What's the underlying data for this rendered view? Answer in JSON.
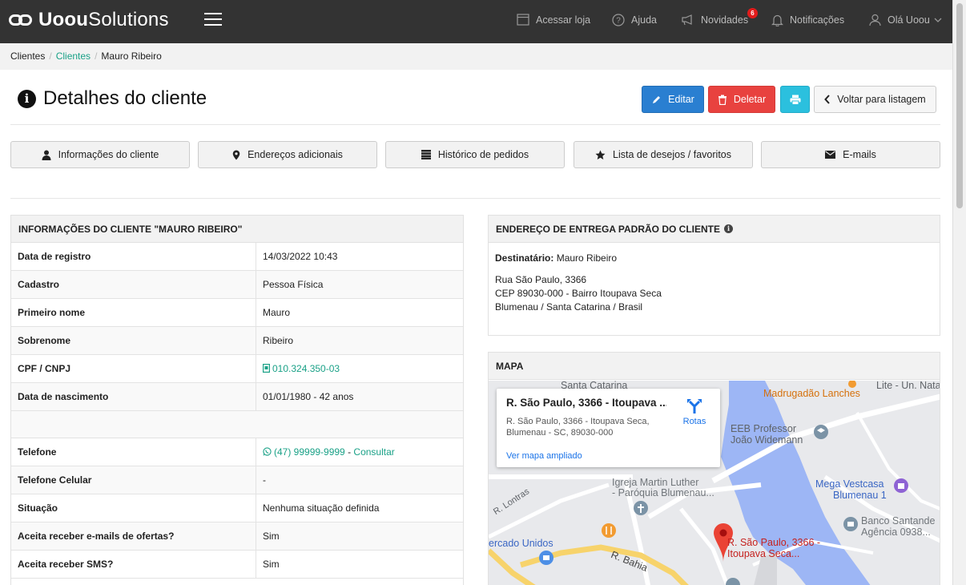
{
  "topbar": {
    "logo_bold": "Uoou",
    "logo_rest": "Solutions",
    "nav": {
      "store": "Acessar loja",
      "help": "Ajuda",
      "news": "Novidades",
      "news_badge": "6",
      "notifications": "Notificações",
      "user": "Olá Uoou"
    }
  },
  "breadcrumb": {
    "root": "Clientes",
    "section": "Clientes",
    "current": "Mauro Ribeiro"
  },
  "page": {
    "title": "Detalhes do cliente",
    "buttons": {
      "edit": "Editar",
      "delete": "Deletar",
      "back": "Voltar para listagem"
    }
  },
  "tabs": [
    {
      "label": "Informações do cliente",
      "icon": "user-icon"
    },
    {
      "label": "Endereços adicionais",
      "icon": "map-pin-icon"
    },
    {
      "label": "Histórico de pedidos",
      "icon": "list-icon"
    },
    {
      "label": "Lista de desejos / favoritos",
      "icon": "star-icon"
    },
    {
      "label": "E-mails",
      "icon": "envelope-icon"
    }
  ],
  "client_info": {
    "title": "INFORMAÇÕES DO CLIENTE \"MAURO RIBEIRO\"",
    "rows": [
      {
        "key": "Data de registro",
        "value": "14/03/2022 10:43"
      },
      {
        "key": "Cadastro",
        "value": "Pessoa Física"
      },
      {
        "key": "Primeiro nome",
        "value": "Mauro"
      },
      {
        "key": "Sobrenome",
        "value": "Ribeiro"
      },
      {
        "key": "CPF / CNPJ",
        "value": "010.324.350-03"
      },
      {
        "key": "Data de nascimento",
        "value": "01/01/1980 - 42 anos"
      }
    ],
    "phone_key": "Telefone",
    "phone_value": "(47) 99999-9999",
    "phone_sep": " - ",
    "phone_link": "Consultar",
    "rows2": [
      {
        "key": "Telefone Celular",
        "value": "-"
      },
      {
        "key": "Situação",
        "value": "Nenhuma situação definida"
      },
      {
        "key": "Aceita receber e-mails de ofertas?",
        "value": "Sim"
      },
      {
        "key": "Aceita receber SMS?",
        "value": "Sim"
      }
    ]
  },
  "delivery": {
    "title": "ENDEREÇO DE ENTREGA PADRÃO DO CLIENTE",
    "recipient_label": "Destinatário:",
    "recipient": "Mauro Ribeiro",
    "line1": "Rua São Paulo, 3366",
    "line2": "CEP 89030-000 - Bairro Itoupava Seca",
    "line3": "Blumenau / Santa Catarina / Brasil"
  },
  "map": {
    "title": "MAPA",
    "card_title": "R. São Paulo, 3366 - Itoupava ...",
    "card_address": "R. São Paulo, 3366 - Itoupava Seca, Blumenau - SC, 89030-000",
    "card_link": "Ver mapa ampliado",
    "routes": "Rotas",
    "labels": {
      "santa_catarina": "Santa Catarina",
      "madrugadao": "Madrugadão Lanches",
      "lite": "Lite - Un. Nata",
      "eeb1": "EEB Professor",
      "eeb2": "João Widemann",
      "mega1": "Mega Vestcasa",
      "mega2": "Blumenau 1",
      "igreja1": "Igreja Martin Luther",
      "igreja2": "- Paróquia Blumenau...",
      "lontras": "R. Lontras",
      "banco1": "Banco Santande",
      "banco2": "Agência 0938...",
      "mercado": "ercado Unidos",
      "bahia": "R. Bahia",
      "pin1": "R. São Paulo, 3366 -",
      "pin2": "Itoupava Seca..."
    }
  }
}
